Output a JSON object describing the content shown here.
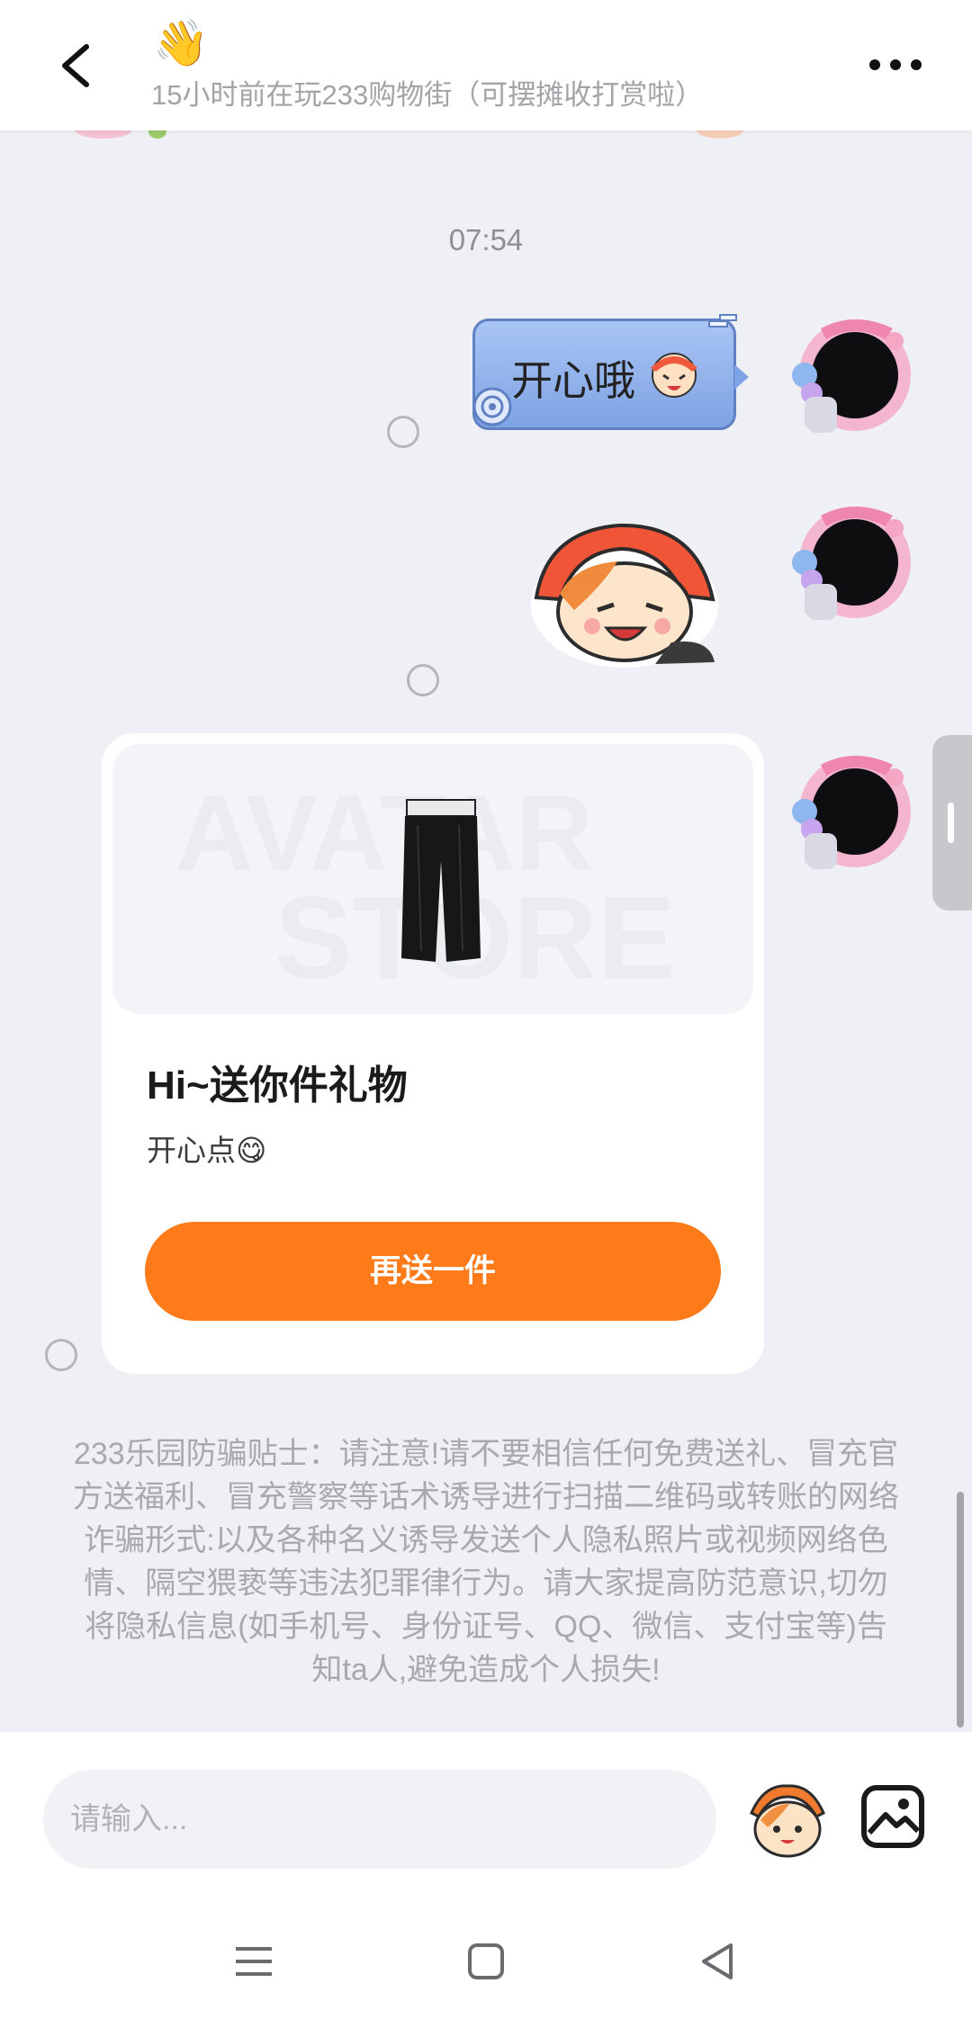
{
  "header": {
    "emoji": "👋",
    "status": "15小时前在玩233购物街（可摆摊收打赏啦）",
    "back_icon": "chevron-left-icon",
    "more_icon": "more-horizontal-icon"
  },
  "chat": {
    "timestamp": "07:54",
    "messages": [
      {
        "type": "text",
        "text": "开心哦",
        "sticker_icon": "cartoon-face-icon"
      },
      {
        "type": "sticker",
        "sticker_icon": "cartoon-character-sticker"
      },
      {
        "type": "gift",
        "image_watermark_line1": "AVATAR",
        "image_watermark_line2": "STORE",
        "title": "Hi~送你件礼物",
        "message": "开心点😋",
        "button_label": "再送一件"
      }
    ]
  },
  "safety_tip": "233乐园防骗贴士：请注意!请不要相信任何免费送礼、冒充官方送福利、冒充警察等话术诱导进行扫描二维码或转账的网络诈骗形式:以及各种名义诱导发送个人隐私照片或视频网络色情、隔空猥亵等违法犯罪律行为。请大家提高防范意识,切勿将隐私信息(如手机号、身份证号、QQ、微信、支付宝等)告知ta人,避免造成个人损失!",
  "input_bar": {
    "placeholder": "请输入...",
    "emoji_icon": "emoji-mascot-icon",
    "image_icon": "image-icon"
  },
  "system_nav": {
    "menu_icon": "menu-icon",
    "home_icon": "square-home-icon",
    "back_icon": "triangle-back-icon"
  },
  "colors": {
    "accent": "#ff7a18",
    "chat_background": "#eef0f5",
    "bubble_blue": "#8fb1ec"
  }
}
